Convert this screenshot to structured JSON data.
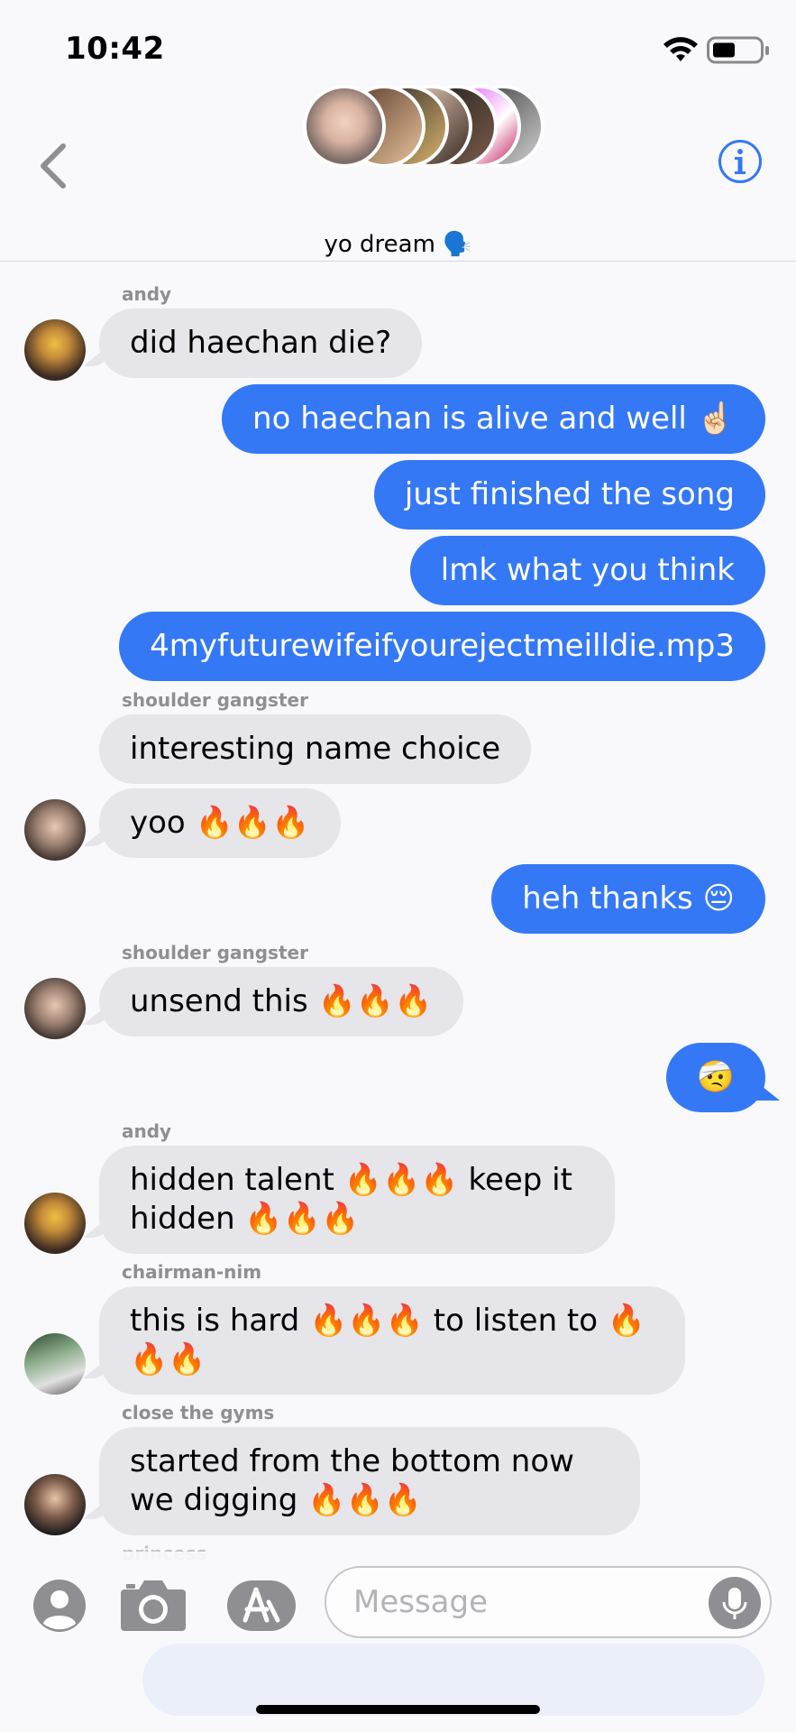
{
  "status_bar": {
    "time": "10:42",
    "wifi_icon": "wifi-icon",
    "battery_icon": "battery-icon"
  },
  "header": {
    "chat_title": "yo dream 🗣️",
    "back_icon": "chevron-left-icon",
    "info_icon": "info-icon"
  },
  "messages": [
    {
      "sender": "andy",
      "text": "did haechan die?",
      "direction": "in"
    },
    {
      "text": "no haechan is alive and well ☝🏻",
      "direction": "out"
    },
    {
      "text": "just finished the song",
      "direction": "out"
    },
    {
      "text": "lmk what you think",
      "direction": "out"
    },
    {
      "text": "4myfuturewifeifyourejectmeilldie.mp3",
      "direction": "out"
    },
    {
      "sender": "shoulder gangster",
      "text": "interesting name choice",
      "direction": "in"
    },
    {
      "text": "yoo 🔥🔥🔥",
      "direction": "in"
    },
    {
      "text": "heh thanks 😔",
      "direction": "out"
    },
    {
      "sender": "shoulder gangster",
      "text": "unsend this 🔥🔥🔥",
      "direction": "in"
    },
    {
      "text": "🤕",
      "direction": "out"
    },
    {
      "sender": "andy",
      "text": "hidden talent 🔥🔥🔥 keep it hidden 🔥🔥🔥",
      "direction": "in"
    },
    {
      "sender": "chairman-nim",
      "text": "this is hard 🔥🔥🔥 to listen to 🔥🔥🔥",
      "direction": "in"
    },
    {
      "sender": "close the gyms",
      "text": "started from the bottom now we digging 🔥🔥🔥",
      "direction": "in"
    },
    {
      "sender": "princess",
      "text": "",
      "direction": "in"
    }
  ],
  "input": {
    "placeholder": "Message"
  },
  "colors": {
    "outgoing": "#3478f6",
    "incoming": "#e5e5ea",
    "sender_label": "#8e8e93"
  }
}
